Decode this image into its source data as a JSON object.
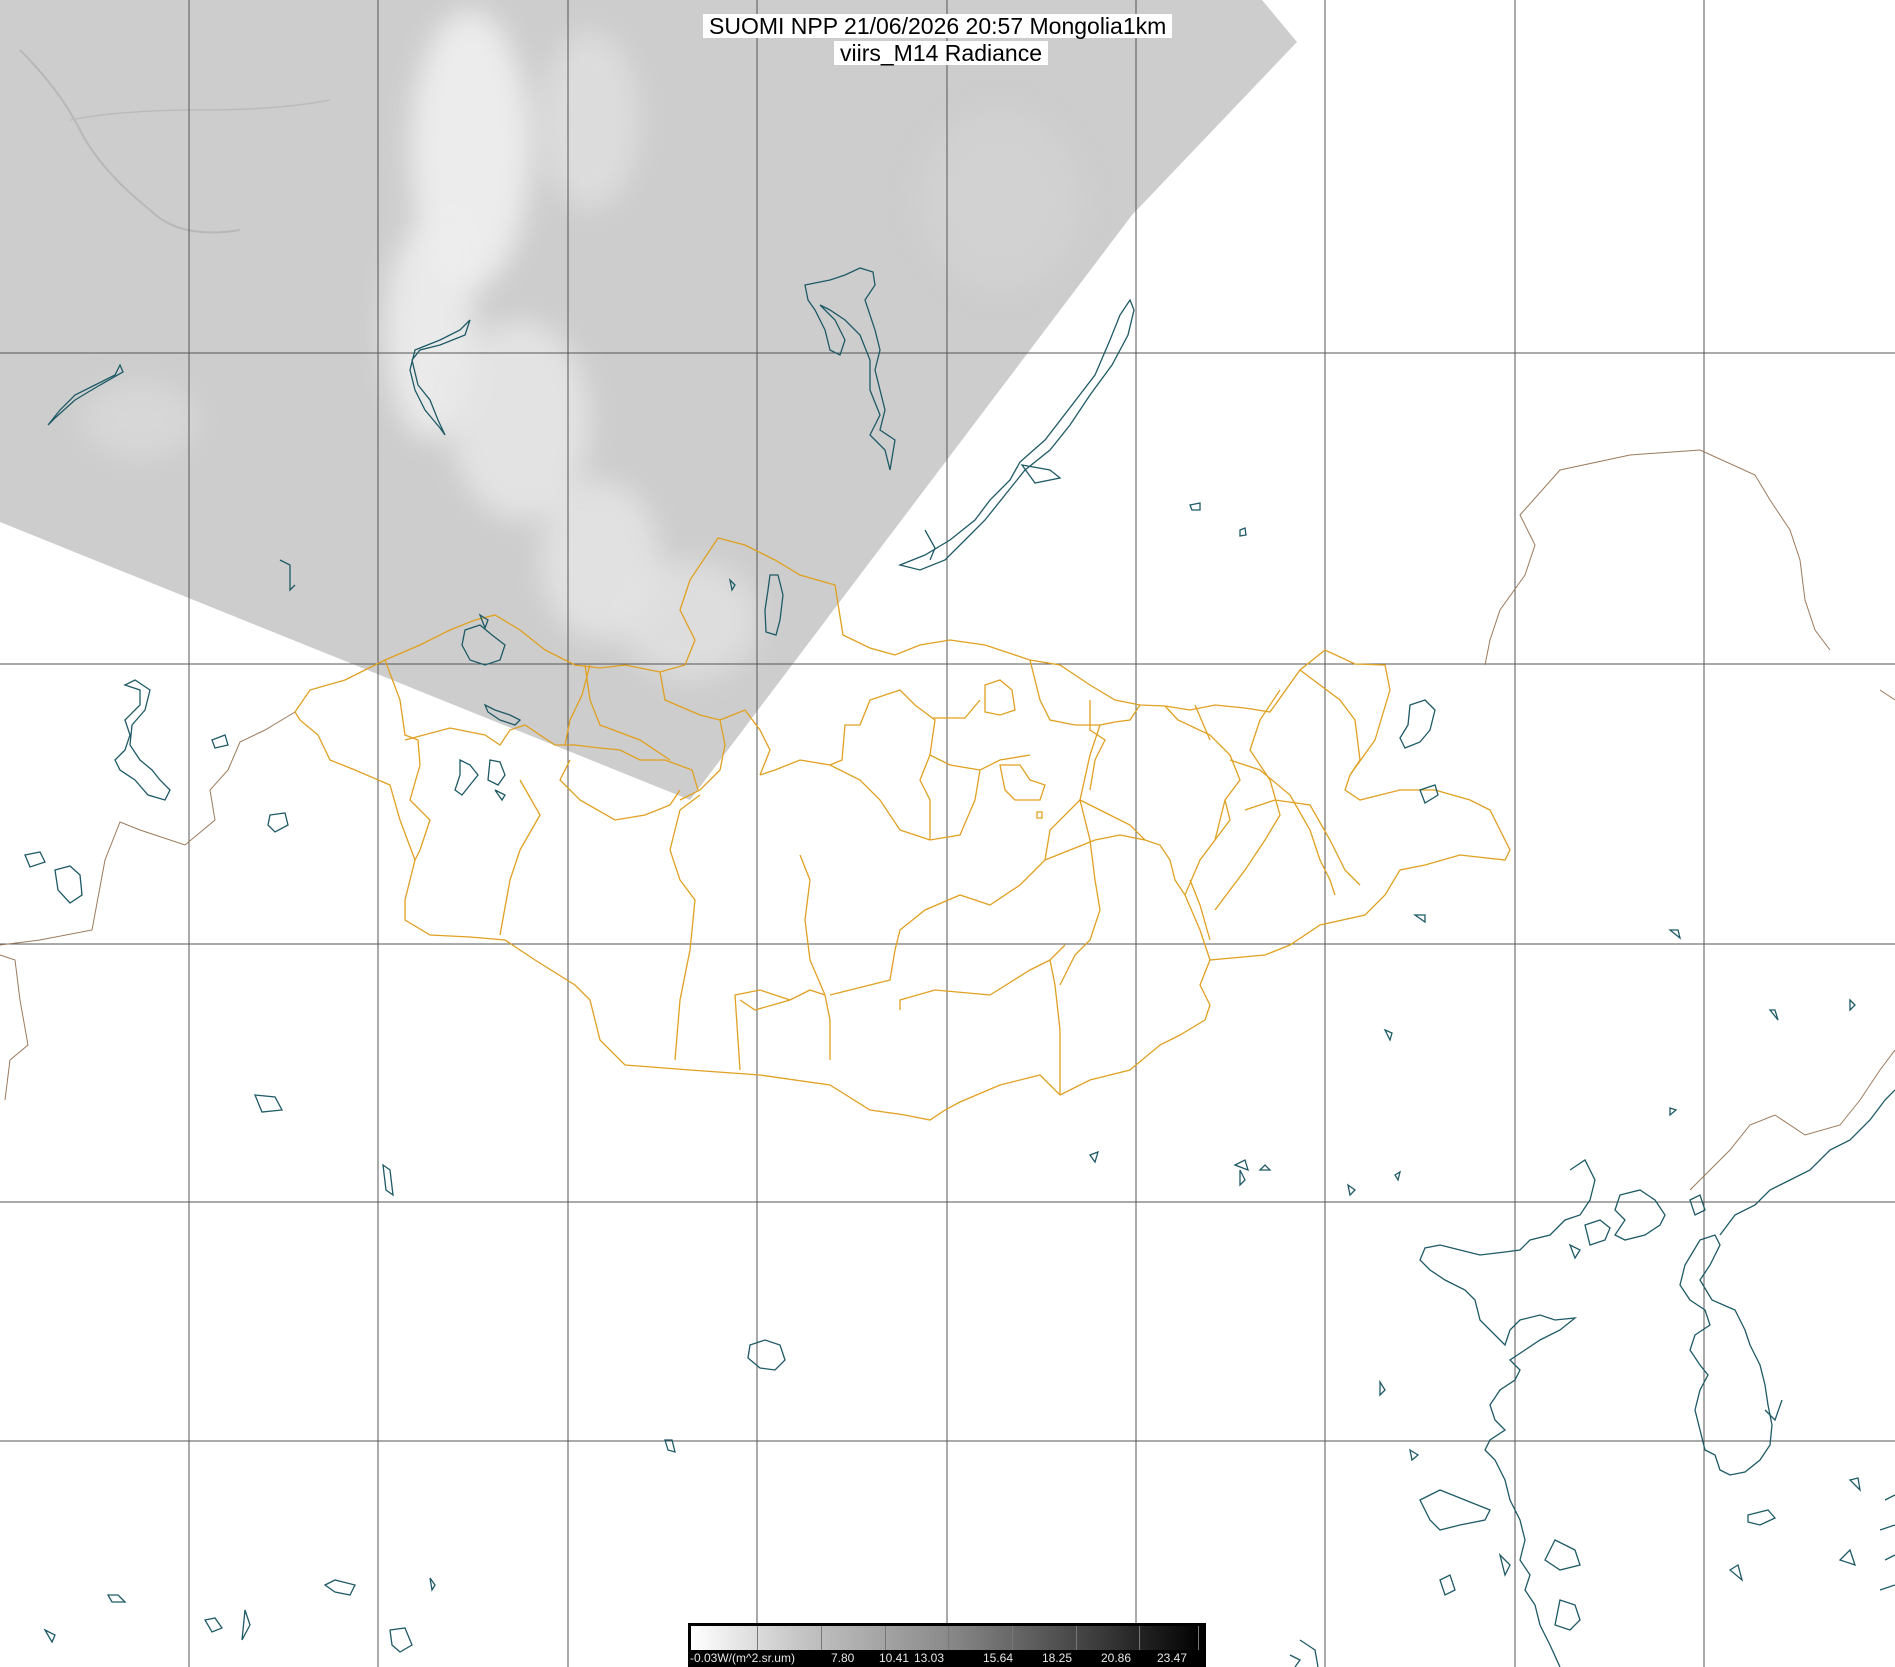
{
  "title": {
    "line1": "SUOMI NPP 21/06/2026 20:57 Mongolia1km",
    "line2": "viirs_M14 Radiance"
  },
  "legend": {
    "unit_label": "-0.03W/(m^2.sr.um)",
    "ticks": [
      "7.80",
      "10.41",
      "13.03",
      "15.64",
      "18.25",
      "20.86",
      "23.47"
    ]
  },
  "colors": {
    "grid": "#555555",
    "coastline": "#1e5a66",
    "admin_border": "#e0a020",
    "country_border": "#9c7a5c",
    "swath": "#cfcfcf",
    "cloud": "#f2f2f2"
  },
  "icons": [
    "lake-outline-icon",
    "coastline-icon"
  ]
}
